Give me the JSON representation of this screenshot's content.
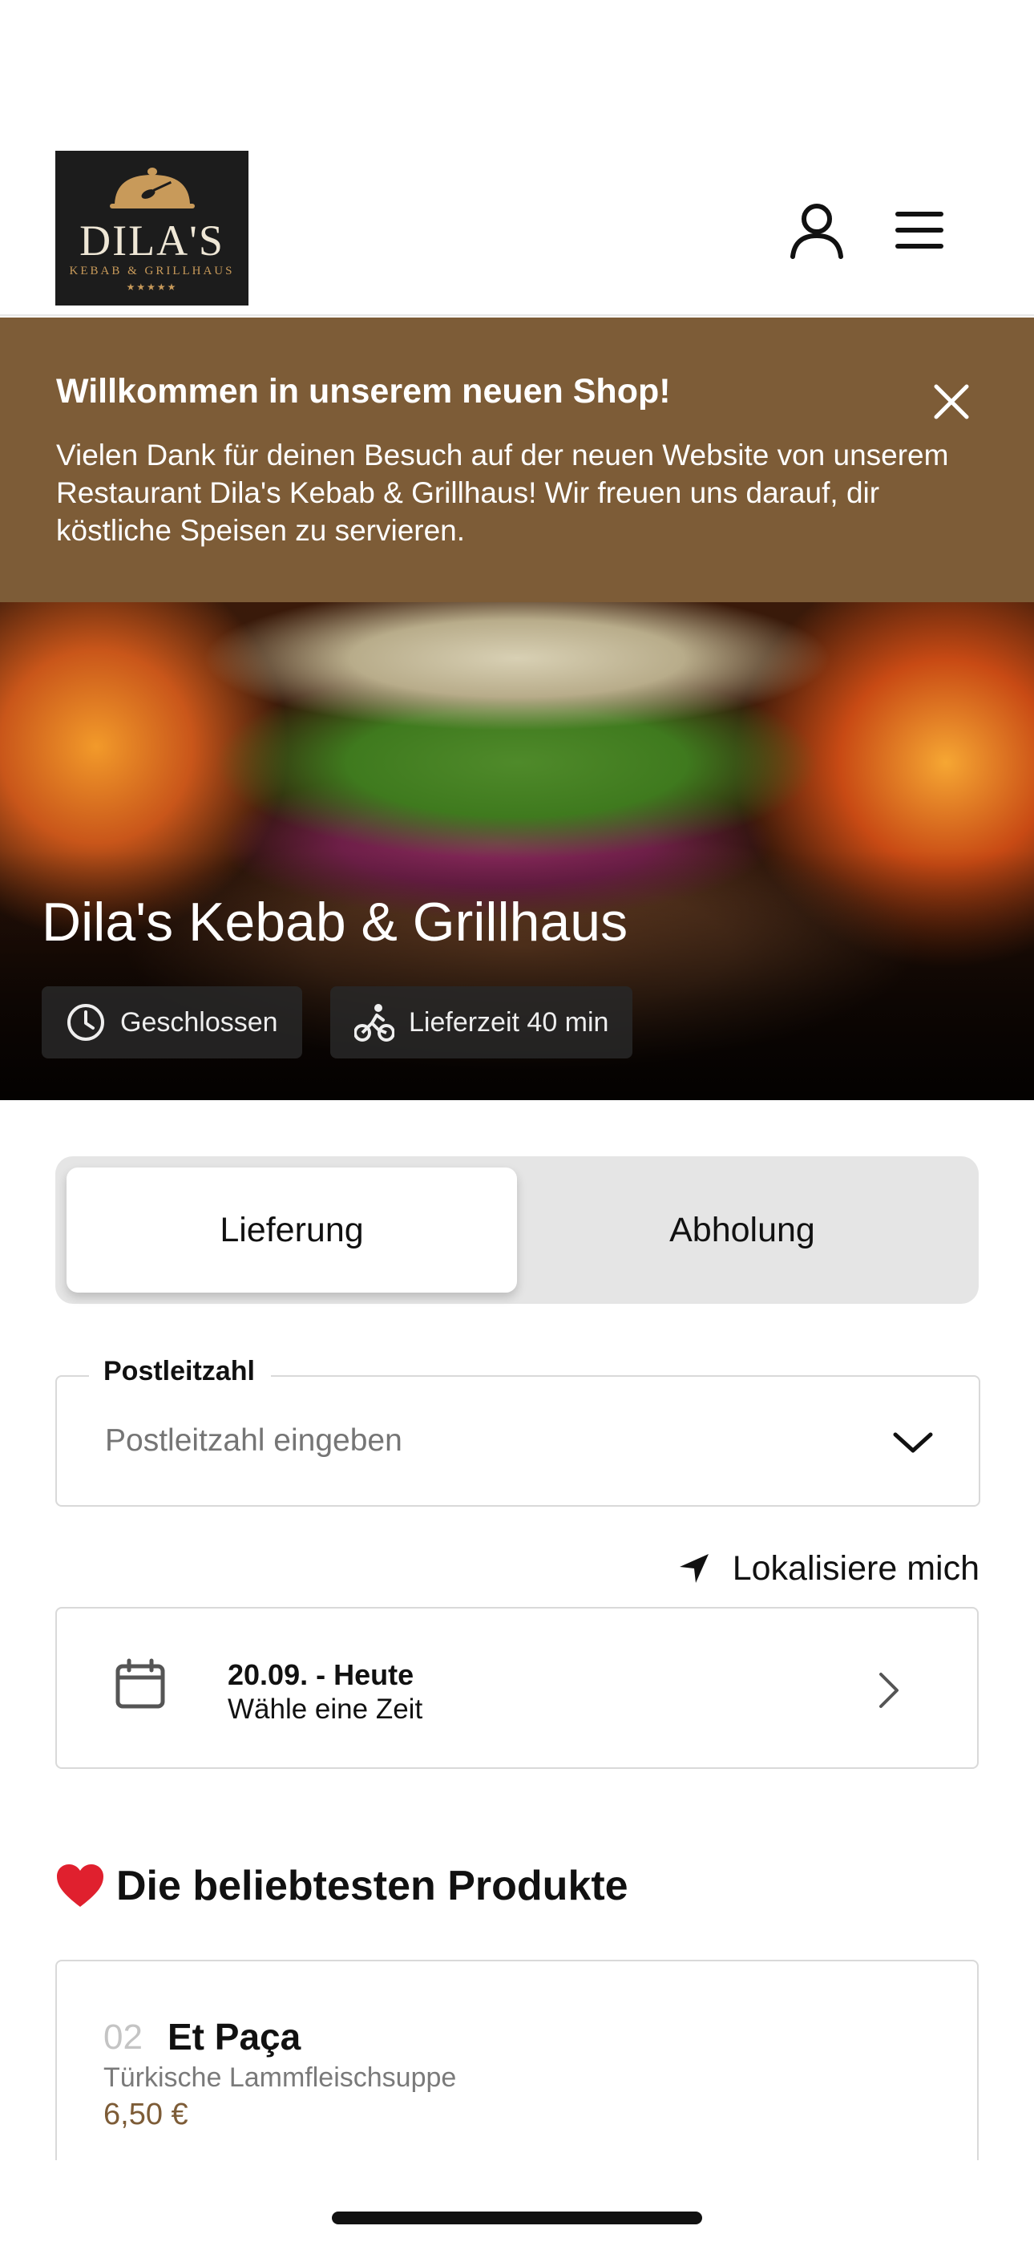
{
  "header": {
    "logo": {
      "name": "DILA'S",
      "subtitle": "KEBAB & GRILLHAUS",
      "stars": "★★★★★"
    },
    "icons": {
      "account": "user-icon",
      "menu": "hamburger-menu-icon"
    }
  },
  "welcome": {
    "title": "Willkommen in unserem neuen Shop!",
    "text": "Vielen Dank für deinen Besuch auf der neuen Website von unserem Restaurant Dila's Kebab & Grillhaus! Wir freuen uns darauf, dir köstliche Speisen zu servieren.",
    "close_icon": "close-icon",
    "background": "#7d5c37"
  },
  "hero": {
    "title": "Dila's Kebab & Grillhaus",
    "status": "Geschlossen",
    "delivery_time": "Lieferzeit 40 min"
  },
  "order_type": {
    "options": [
      "Lieferung",
      "Abholung"
    ],
    "selected": "Lieferung"
  },
  "postcode": {
    "label": "Postleitzahl",
    "placeholder": "Postleitzahl eingeben",
    "value": ""
  },
  "locate": {
    "label": "Lokalisiere mich",
    "icon": "location-arrow-icon"
  },
  "time_picker": {
    "date": "20.09. - Heute",
    "prompt": "Wähle eine Zeit",
    "icon": "calendar-icon"
  },
  "popular": {
    "title": "Die beliebtesten Produkte",
    "emoji": "❤️",
    "products": [
      {
        "number": "02",
        "name": "Et Paça",
        "description": "Türkische Lammfleischsuppe",
        "price": "6,50 €"
      }
    ]
  },
  "colors": {
    "accent": "#7d5c37",
    "border": "#d9d9d9"
  }
}
